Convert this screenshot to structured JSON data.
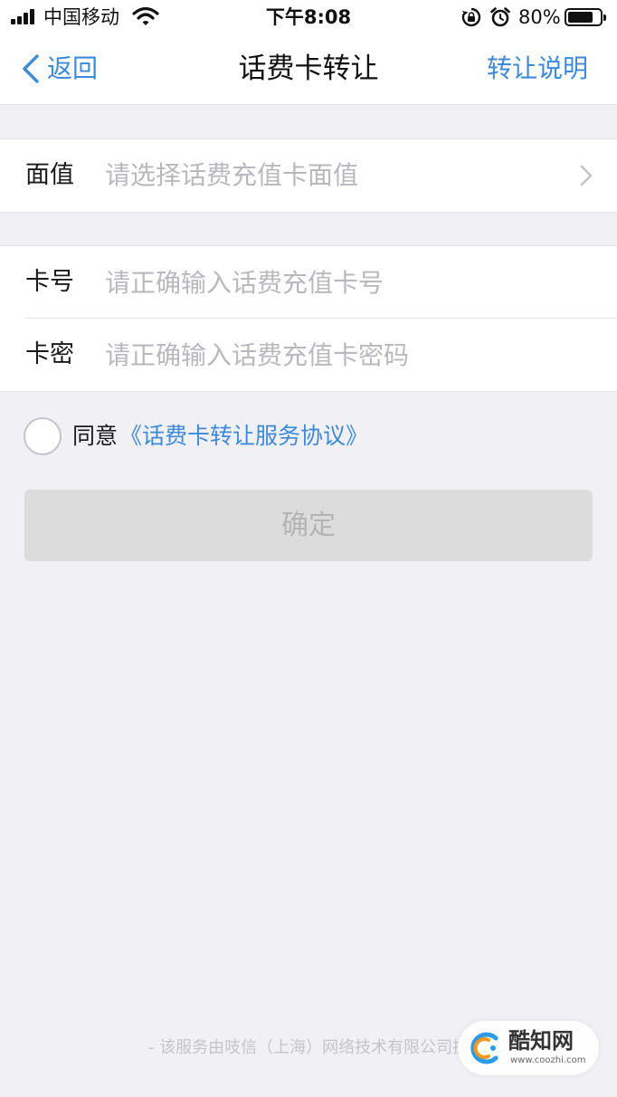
{
  "status_bar": {
    "carrier": "中国移动",
    "time": "下午8:08",
    "battery_percent": "80%",
    "battery_level": 0.8,
    "icons": [
      "signal-icon",
      "wifi-icon",
      "rotation-lock-icon",
      "alarm-icon",
      "battery-icon"
    ]
  },
  "nav": {
    "back_label": "返回",
    "title": "话费卡转让",
    "right_action": "转让说明"
  },
  "form": {
    "face_value": {
      "label": "面值",
      "placeholder": "请选择话费充值卡面值"
    },
    "card_number": {
      "label": "卡号",
      "value": "",
      "placeholder": "请正确输入话费充值卡号"
    },
    "card_password": {
      "label": "卡密",
      "value": "",
      "placeholder": "请正确输入话费充值卡密码"
    }
  },
  "agreement": {
    "checked": false,
    "text": "同意",
    "link_text": "《话费卡转让服务协议》"
  },
  "confirm_label": "确定",
  "footer": {
    "text": "- 该服务由吱信（上海）网络技术有限公司提"
  },
  "watermark": {
    "name": "酷知网",
    "url": "www.coozhi.com"
  },
  "colors": {
    "accent": "#3f8ad8",
    "page_background": "#f0f0f5",
    "placeholder": "#b8b8be",
    "disabled_button": "#dcdcdc"
  }
}
